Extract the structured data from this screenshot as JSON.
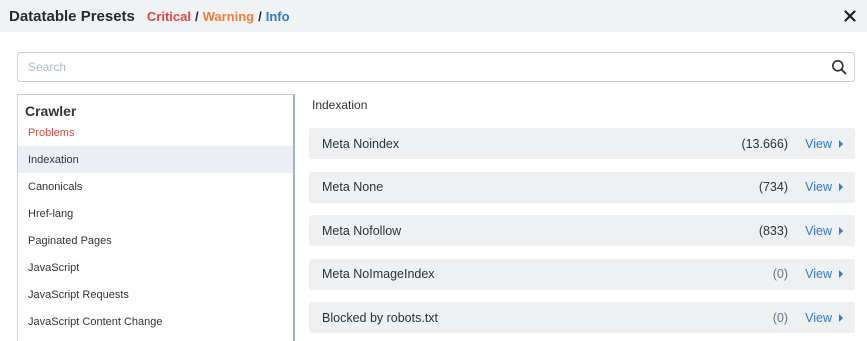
{
  "header": {
    "title": "Datatable Presets",
    "levels": {
      "critical": "Critical",
      "warning": "Warning",
      "info": "Info",
      "separator": "/"
    }
  },
  "search": {
    "placeholder": "Search",
    "value": ""
  },
  "sidebar": {
    "heading": "Crawler",
    "items": [
      {
        "label": "Problems"
      },
      {
        "label": "Indexation"
      },
      {
        "label": "Canonicals"
      },
      {
        "label": "Href-lang"
      },
      {
        "label": "Paginated Pages"
      },
      {
        "label": "JavaScript"
      },
      {
        "label": "JavaScript Requests"
      },
      {
        "label": "JavaScript Content Change"
      }
    ]
  },
  "main": {
    "heading": "Indexation",
    "view_label": "View",
    "rows": [
      {
        "label": "Meta Noindex",
        "count": "(13.666)"
      },
      {
        "label": "Meta None",
        "count": "(734)"
      },
      {
        "label": "Meta Nofollow",
        "count": "(833)"
      },
      {
        "label": "Meta NoImageIndex",
        "count": "(0)"
      },
      {
        "label": "Blocked by robots.txt",
        "count": "(0)"
      }
    ]
  },
  "colors": {
    "critical": "#e0483b",
    "warning": "#f07f3c",
    "info": "#2d79d6",
    "active_bg": "#eceef6"
  }
}
